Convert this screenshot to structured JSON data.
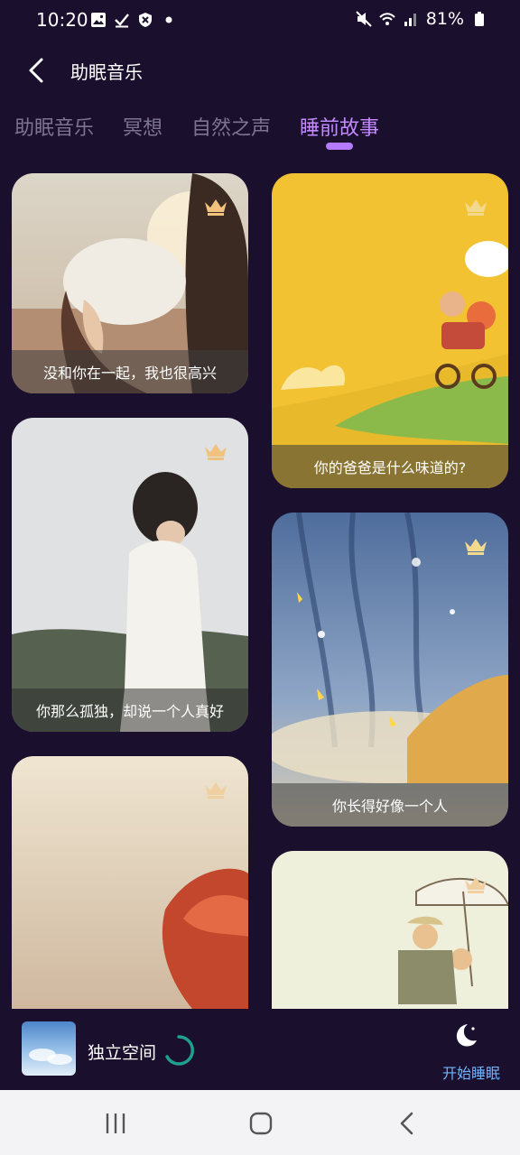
{
  "status": {
    "time": "10:20",
    "battery": "81%",
    "icons": [
      "image-icon",
      "check-icon",
      "shield-icon",
      "dot-icon"
    ],
    "right_icons": [
      "mute-icon",
      "wifi-icon",
      "signal-icon",
      "battery-icon"
    ]
  },
  "header": {
    "title": "助眠音乐"
  },
  "tabs": [
    {
      "label": "助眠音乐",
      "active": false
    },
    {
      "label": "冥想",
      "active": false
    },
    {
      "label": "自然之声",
      "active": false
    },
    {
      "label": "睡前故事",
      "active": true
    }
  ],
  "cards": [
    {
      "caption": "没和你在一起，我也很高兴",
      "premium": true
    },
    {
      "caption": "你的爸爸是什么味道的?",
      "premium": true
    },
    {
      "caption": "你那么孤独，却说一个人真好",
      "premium": true
    },
    {
      "caption": "你长得好像一个人",
      "premium": true
    },
    {
      "caption": "",
      "premium": true
    },
    {
      "caption": "",
      "premium": true
    }
  ],
  "player": {
    "track": "独立空间",
    "sleep_label": "开始睡眠"
  },
  "colors": {
    "background": "#1b0f2e",
    "accent": "#c38bff",
    "link": "#6fb4ff"
  }
}
